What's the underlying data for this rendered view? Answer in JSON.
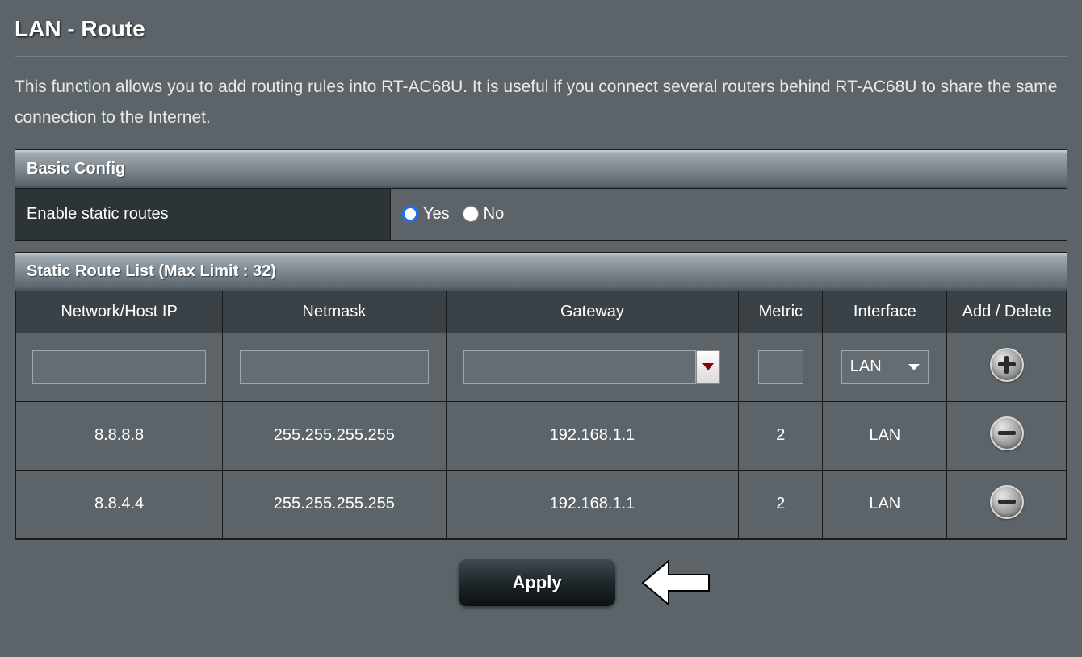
{
  "page": {
    "title": "LAN - Route",
    "description": "This function allows you to add routing rules into RT-AC68U. It is useful if you connect several routers behind RT-AC68U to share the same connection to the Internet."
  },
  "basic_config": {
    "header": "Basic Config",
    "enable_label": "Enable static routes",
    "radio_yes": "Yes",
    "radio_no": "No",
    "selected": "yes"
  },
  "route_list": {
    "header": "Static Route List (Max Limit : 32)",
    "columns": {
      "ip": "Network/Host IP",
      "netmask": "Netmask",
      "gateway": "Gateway",
      "metric": "Metric",
      "interface": "Interface",
      "action": "Add / Delete"
    },
    "new_row": {
      "ip": "",
      "netmask": "",
      "gateway": "",
      "metric": "",
      "interface_selected": "LAN"
    },
    "rows": [
      {
        "ip": "8.8.8.8",
        "netmask": "255.255.255.255",
        "gateway": "192.168.1.1",
        "metric": "2",
        "interface": "LAN"
      },
      {
        "ip": "8.8.4.4",
        "netmask": "255.255.255.255",
        "gateway": "192.168.1.1",
        "metric": "2",
        "interface": "LAN"
      }
    ]
  },
  "buttons": {
    "apply": "Apply"
  }
}
